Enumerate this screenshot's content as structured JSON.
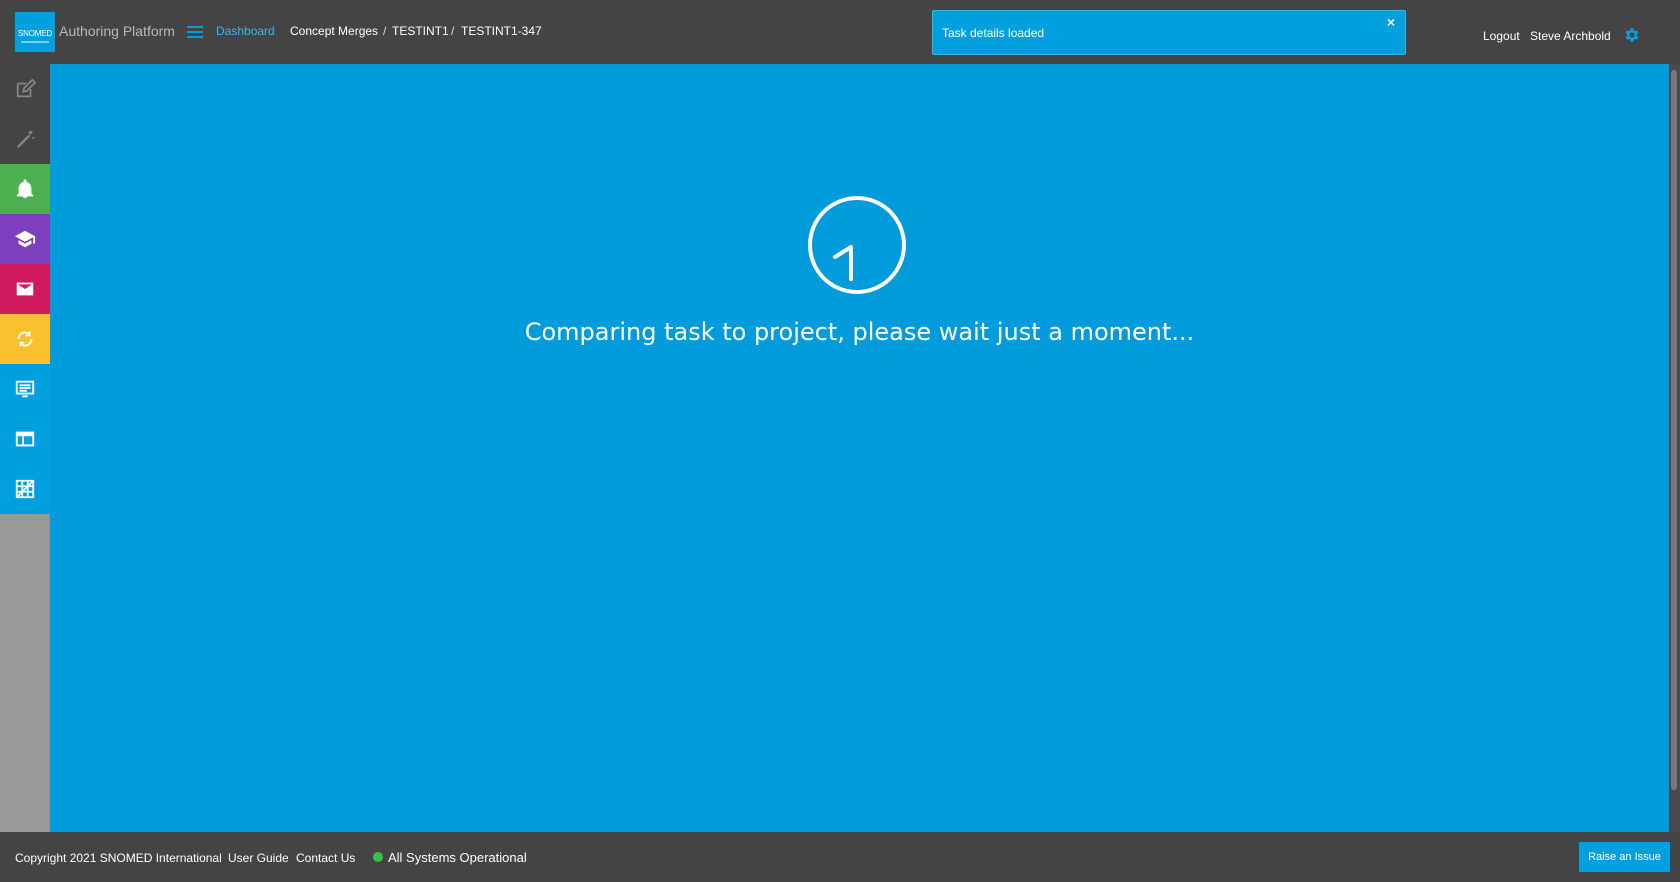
{
  "header": {
    "logo_text": "SNOMED",
    "app_title": "Authoring Platform",
    "breadcrumbs": [
      "Dashboard",
      "Concept Merges",
      "TESTINT1",
      "TESTINT1-347"
    ],
    "separator": "/",
    "logout_label": "Logout",
    "username": "Steve Archbold"
  },
  "toast": {
    "message": "Task details loaded",
    "close_icon": "×"
  },
  "sidebar": {
    "items": [
      {
        "name": "edit-icon",
        "color": "#444444"
      },
      {
        "name": "magic-wand-icon",
        "color": "#444444"
      },
      {
        "name": "bell-icon",
        "color": "#4caf50"
      },
      {
        "name": "graduation-cap-icon",
        "color": "#7e3fbf"
      },
      {
        "name": "mail-icon",
        "color": "#d0195f"
      },
      {
        "name": "sync-icon",
        "color": "#fbc02d"
      },
      {
        "name": "monitor-list-icon",
        "color": "#009fde"
      },
      {
        "name": "browser-window-icon",
        "color": "#009fde"
      },
      {
        "name": "grid-icon",
        "color": "#009fde"
      }
    ]
  },
  "main": {
    "loading_message": "Comparing task to project, please wait just a moment..."
  },
  "footer": {
    "copyright": "Copyright 2021 SNOMED International",
    "user_guide": "User Guide",
    "contact_us": "Contact Us",
    "status": "All Systems Operational",
    "raise_issue": "Raise an Issue"
  },
  "colors": {
    "accent": "#009fde",
    "header_bg": "#444444",
    "main_bg": "#009bda"
  }
}
